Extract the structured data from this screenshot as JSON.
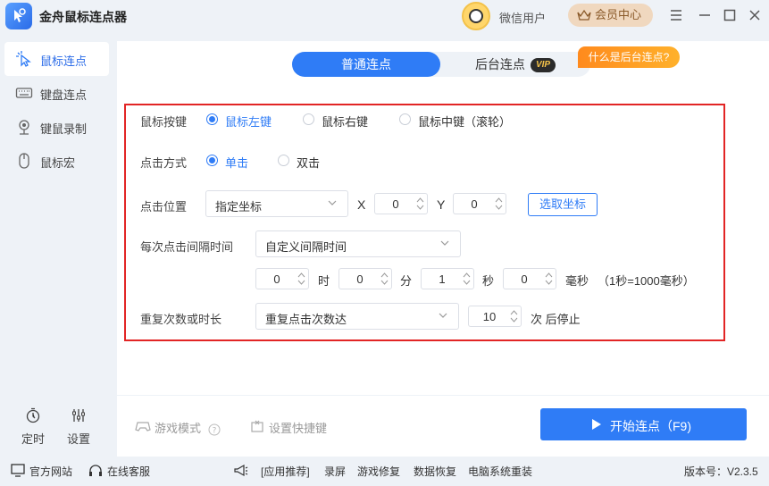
{
  "app": {
    "title": "金舟鼠标连点器"
  },
  "header": {
    "username": "微信用户",
    "vip_center": "会员中心"
  },
  "sidebar": {
    "items": [
      {
        "label": "鼠标连点",
        "icon": "mouse-click-icon",
        "active": true
      },
      {
        "label": "键盘连点",
        "icon": "keyboard-icon",
        "active": false
      },
      {
        "label": "键鼠录制",
        "icon": "record-icon",
        "active": false
      },
      {
        "label": "鼠标宏",
        "icon": "mouse-icon",
        "active": false
      }
    ],
    "timer_label": "定时",
    "settings_label": "设置"
  },
  "tabs": {
    "normal": "普通连点",
    "background": "后台连点",
    "vip_badge": "VIP",
    "hint": "什么是后台连点?"
  },
  "settings": {
    "mouse_button": {
      "label": "鼠标按键",
      "options": [
        "鼠标左键",
        "鼠标右键",
        "鼠标中键（滚轮）"
      ],
      "selected": "鼠标左键"
    },
    "click_type": {
      "label": "点击方式",
      "options": [
        "单击",
        "双击"
      ],
      "selected": "单击"
    },
    "position": {
      "label": "点击位置",
      "mode": "指定坐标",
      "x_label": "X",
      "x_value": "0",
      "y_label": "Y",
      "y_value": "0",
      "pick_button": "选取坐标"
    },
    "interval": {
      "label": "每次点击间隔时间",
      "mode": "自定义间隔时间",
      "hours": "0",
      "hours_unit": "时",
      "minutes": "0",
      "minutes_unit": "分",
      "seconds": "1",
      "seconds_unit": "秒",
      "ms": "0",
      "ms_unit": "毫秒",
      "ms_note": "（1秒=1000毫秒）"
    },
    "repeat": {
      "label": "重复次数或时长",
      "mode": "重复点击次数达",
      "count": "10",
      "suffix": "次 后停止"
    }
  },
  "actions": {
    "game_mode": "游戏模式",
    "shortcut": "设置快捷键",
    "start": "开始连点（F9)"
  },
  "footer": {
    "website": "官方网站",
    "support": "在线客服",
    "recommend": "[应用推荐]",
    "links": [
      "录屏",
      "游戏修复",
      "数据恢复",
      "电脑系统重装"
    ],
    "version": "版本号：V2.3.5"
  },
  "colors": {
    "accent": "#2f7cf6",
    "highlight_border": "#e22525",
    "vip": "#f0d8bf"
  }
}
